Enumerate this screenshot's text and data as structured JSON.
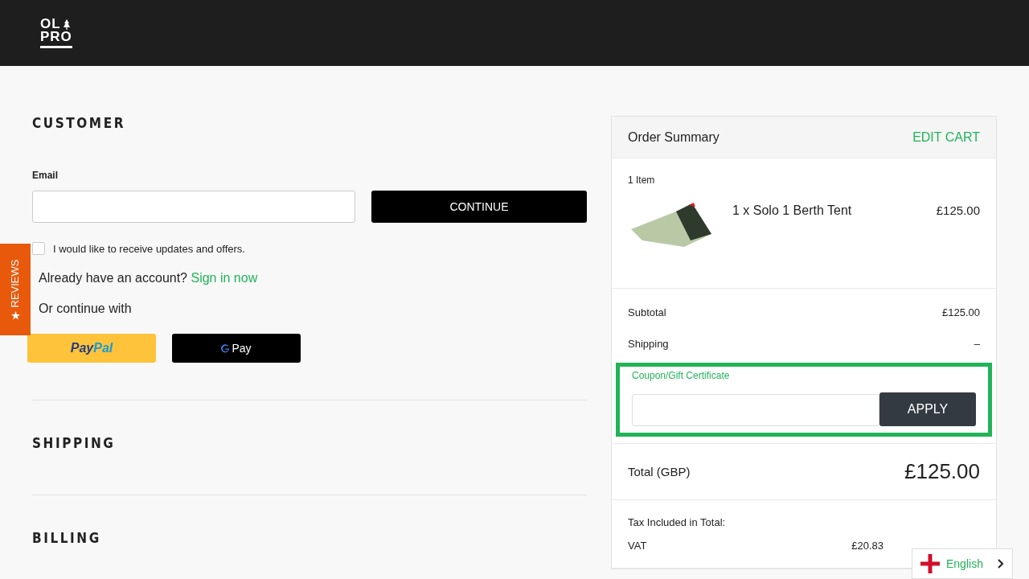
{
  "header": {
    "logo": [
      "OL",
      "PRO"
    ]
  },
  "reviews_tab": {
    "label": "REVIEWS"
  },
  "customer": {
    "heading": "CUSTOMER",
    "email_label": "Email",
    "continue": "CONTINUE",
    "updates": {
      "label": "I would like to receive updates and offers.",
      "checked": false
    },
    "account_text": "Already have an account?",
    "sign_in": "Sign in now",
    "continue_with": "Or continue with",
    "paypal": [
      "Pay",
      "Pal"
    ],
    "gpay": "Pay"
  },
  "sections": [
    "SHIPPING",
    "BILLING"
  ],
  "summary": {
    "title": "Order Summary",
    "edit": "EDIT CART",
    "count": "1 Item",
    "items": [
      {
        "name": "1 x Solo 1 Berth Tent",
        "price": "£125.00"
      }
    ],
    "rows": [
      {
        "label": "Subtotal",
        "value": "£125.00"
      },
      {
        "label": "Shipping",
        "value": "–"
      }
    ],
    "coupon": {
      "label": "Coupon/Gift Certificate",
      "button": "APPLY"
    },
    "total": {
      "label": "Total (GBP)",
      "value": "£125.00"
    },
    "tax_heading": "Tax Included in Total:",
    "tax": [
      {
        "label": "VAT",
        "value": "£20.83"
      }
    ]
  },
  "language": {
    "label": "English"
  }
}
